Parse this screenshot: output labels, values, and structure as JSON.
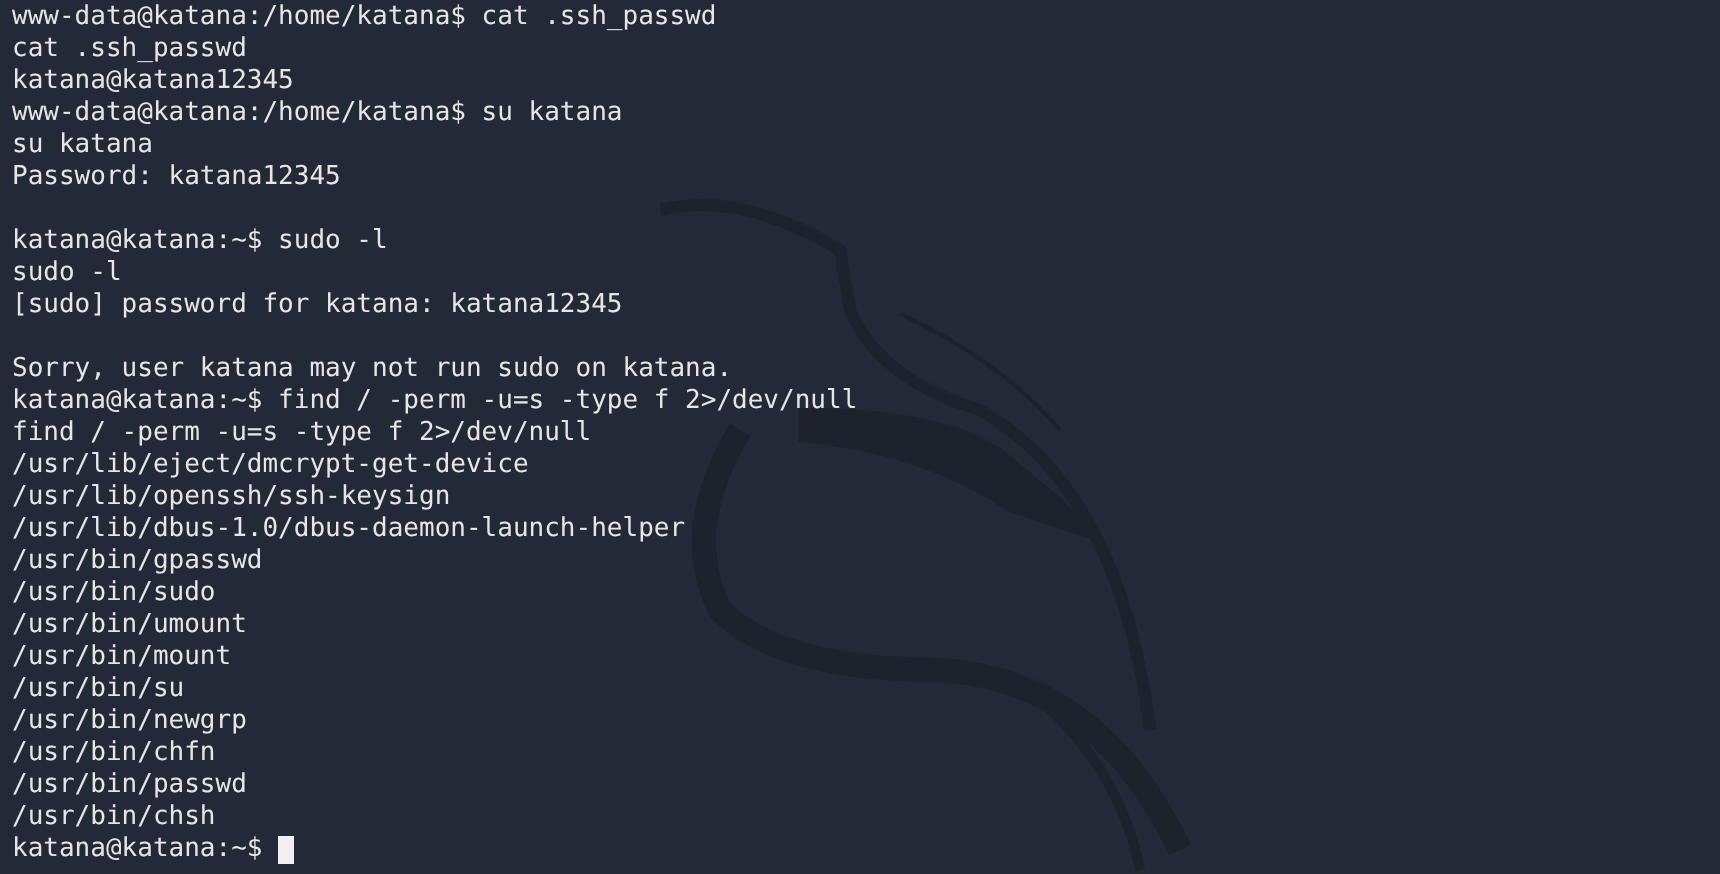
{
  "terminal": {
    "lines": [
      {
        "kind": "text",
        "text": "www-data@katana:/home/katana$ cat .ssh_passwd"
      },
      {
        "kind": "text",
        "text": "cat .ssh_passwd"
      },
      {
        "kind": "text",
        "text": "katana@katana12345"
      },
      {
        "kind": "text",
        "text": "www-data@katana:/home/katana$ su katana"
      },
      {
        "kind": "text",
        "text": "su katana"
      },
      {
        "kind": "text",
        "text": "Password: katana12345"
      },
      {
        "kind": "blank"
      },
      {
        "kind": "text",
        "text": "katana@katana:~$ sudo -l"
      },
      {
        "kind": "text",
        "text": "sudo -l"
      },
      {
        "kind": "text",
        "text": "[sudo] password for katana: katana12345"
      },
      {
        "kind": "blank"
      },
      {
        "kind": "text",
        "text": "Sorry, user katana may not run sudo on katana."
      },
      {
        "kind": "text",
        "text": "katana@katana:~$ find / -perm -u=s -type f 2>/dev/null"
      },
      {
        "kind": "text",
        "text": "find / -perm -u=s -type f 2>/dev/null"
      },
      {
        "kind": "text",
        "text": "/usr/lib/eject/dmcrypt-get-device"
      },
      {
        "kind": "text",
        "text": "/usr/lib/openssh/ssh-keysign"
      },
      {
        "kind": "text",
        "text": "/usr/lib/dbus-1.0/dbus-daemon-launch-helper"
      },
      {
        "kind": "text",
        "text": "/usr/bin/gpasswd"
      },
      {
        "kind": "text",
        "text": "/usr/bin/sudo"
      },
      {
        "kind": "text",
        "text": "/usr/bin/umount"
      },
      {
        "kind": "text",
        "text": "/usr/bin/mount"
      },
      {
        "kind": "text",
        "text": "/usr/bin/su"
      },
      {
        "kind": "text",
        "text": "/usr/bin/newgrp"
      },
      {
        "kind": "text",
        "text": "/usr/bin/chfn"
      },
      {
        "kind": "text",
        "text": "/usr/bin/passwd"
      },
      {
        "kind": "text",
        "text": "/usr/bin/chsh"
      }
    ],
    "prompt": {
      "text": "katana@katana:~$",
      "cursor": true
    }
  }
}
